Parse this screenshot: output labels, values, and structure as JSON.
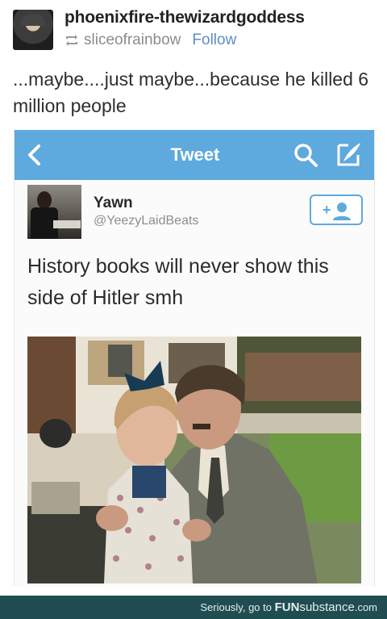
{
  "post": {
    "username": "phoenixfire-thewizardgoddess",
    "reblogged_from": "sliceofrainbow",
    "follow_label": "Follow",
    "caption": "...maybe....just maybe...because he killed 6 million people"
  },
  "tweet": {
    "nav_title": "Tweet",
    "author_name": "Yawn",
    "author_handle": "@YeezyLaidBeats",
    "text": "History books will never show this side of Hitler smh",
    "follow_button_symbol": "+",
    "accent_color": "#5ea9dd"
  },
  "footer": {
    "text_prefix": "Seriously, go to ",
    "brand": "FUN",
    "brand_rest": "substance",
    "brand_tld": ".com"
  }
}
